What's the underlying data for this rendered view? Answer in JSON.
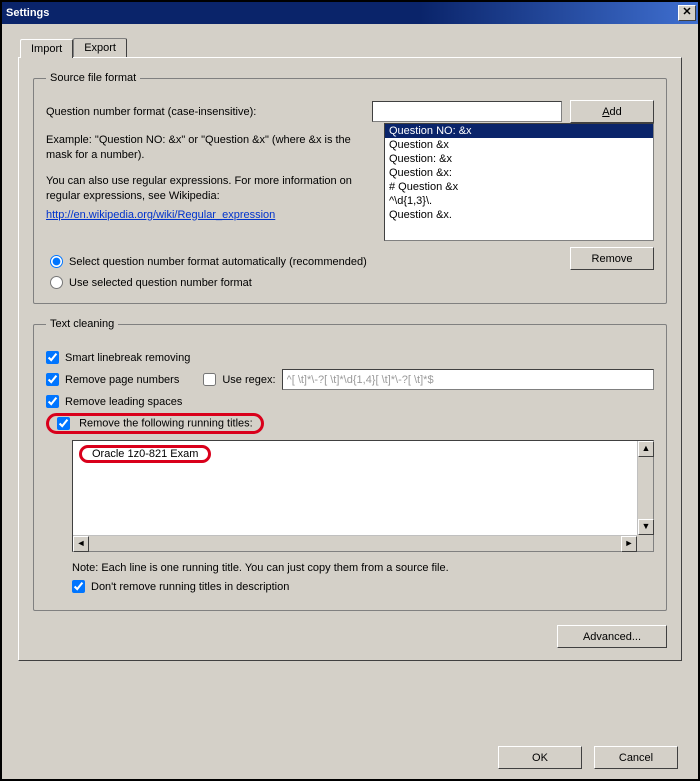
{
  "window": {
    "title": "Settings"
  },
  "tabs": {
    "import": "Import",
    "export": "Export"
  },
  "source": {
    "legend": "Source file format",
    "qnum_label": "Question number format (case-insensitive):",
    "qnum_value": "",
    "add_label": "Add",
    "example_text": "Example: \"Question NO: &x\" or \"Question &x\" (where &x is the mask for a number).",
    "info_text": "You can also use regular expressions. For more information on regular expressions, see Wikipedia:",
    "link_text": "http://en.wikipedia.org/wiki/Regular_expression",
    "list": [
      "Question NO: &x",
      "Question &x",
      "Question: &x",
      "Question &x:",
      "# Question &x",
      "^\\d{1,3}\\.",
      "Question &x."
    ],
    "selected_index": 0,
    "radio_auto": "Select question number format automatically (recommended)",
    "radio_sel": "Use selected question number format",
    "remove_label": "Remove"
  },
  "clean": {
    "legend": "Text cleaning",
    "smart": "Smart linebreak removing",
    "pagenums": "Remove page numbers",
    "useregex": "Use regex:",
    "regex_placeholder": "^[ \\t]*\\-?[ \\t]*\\d{1,4}[ \\t]*\\-?[ \\t]*$",
    "leading": "Remove leading spaces",
    "runtitles": "Remove the following running titles:",
    "runtitles_value": "Oracle 1z0-821 Exam",
    "note": "Note: Each line is one running title. You can just copy them from a source file.",
    "dontremove": "Don't remove running titles in description"
  },
  "buttons": {
    "advanced": "Advanced...",
    "ok": "OK",
    "cancel": "Cancel"
  }
}
